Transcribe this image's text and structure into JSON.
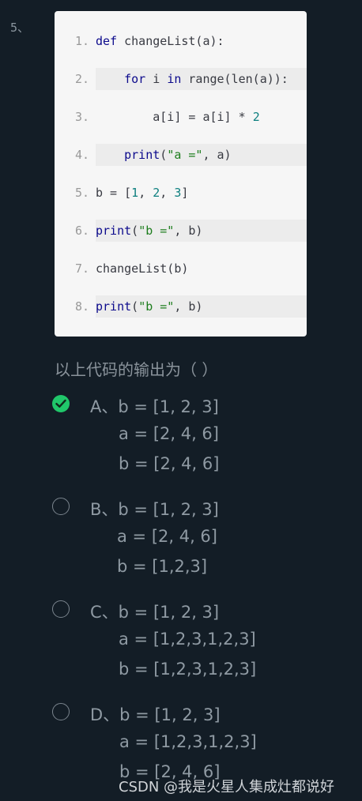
{
  "question_number": "5、",
  "code": {
    "lines": [
      {
        "n": "1.",
        "parts": [
          {
            "t": "def ",
            "c": "kw"
          },
          {
            "t": "changeList(a):",
            "c": "fn"
          }
        ]
      },
      {
        "n": "2.",
        "parts": [
          {
            "t": "    ",
            "c": "op"
          },
          {
            "t": "for",
            "c": "kw"
          },
          {
            "t": " i ",
            "c": "op"
          },
          {
            "t": "in",
            "c": "kw"
          },
          {
            "t": " range(len(a)):",
            "c": "fn"
          }
        ]
      },
      {
        "n": "3.",
        "parts": [
          {
            "t": "        a[i] = a[i] * ",
            "c": "op"
          },
          {
            "t": "2",
            "c": "num"
          }
        ]
      },
      {
        "n": "4.",
        "parts": [
          {
            "t": "    ",
            "c": "op"
          },
          {
            "t": "print",
            "c": "kw"
          },
          {
            "t": "(",
            "c": "op"
          },
          {
            "t": "\"a =\"",
            "c": "str"
          },
          {
            "t": ", a)",
            "c": "op"
          }
        ]
      },
      {
        "n": "5.",
        "parts": [
          {
            "t": "b = [",
            "c": "op"
          },
          {
            "t": "1",
            "c": "num"
          },
          {
            "t": ", ",
            "c": "op"
          },
          {
            "t": "2",
            "c": "num"
          },
          {
            "t": ", ",
            "c": "op"
          },
          {
            "t": "3",
            "c": "num"
          },
          {
            "t": "]",
            "c": "op"
          }
        ]
      },
      {
        "n": "6.",
        "parts": [
          {
            "t": "print",
            "c": "kw"
          },
          {
            "t": "(",
            "c": "op"
          },
          {
            "t": "\"b =\"",
            "c": "str"
          },
          {
            "t": ", b)",
            "c": "op"
          }
        ]
      },
      {
        "n": "7.",
        "parts": [
          {
            "t": "changeList(b)",
            "c": "fn"
          }
        ]
      },
      {
        "n": "8.",
        "parts": [
          {
            "t": "print",
            "c": "kw"
          },
          {
            "t": "(",
            "c": "op"
          },
          {
            "t": "\"b =\"",
            "c": "str"
          },
          {
            "t": ", b)",
            "c": "op"
          }
        ]
      }
    ],
    "highlighted_lines": [
      2,
      4,
      6,
      8
    ]
  },
  "question_text": "以上代码的输出为（ ）",
  "options": [
    {
      "id": "A",
      "selected": true,
      "lines": [
        "A、b = [1, 2, 3]",
        "a = [2, 4, 6]",
        "b = [2, 4, 6]"
      ]
    },
    {
      "id": "B",
      "selected": false,
      "lines": [
        "B、b = [1, 2, 3]",
        "a = [2, 4, 6]",
        "b = [1,2,3]"
      ]
    },
    {
      "id": "C",
      "selected": false,
      "lines": [
        "C、b = [1, 2, 3]",
        "a = [1,2,3,1,2,3]",
        "b = [1,2,3,1,2,3]"
      ]
    },
    {
      "id": "D",
      "selected": false,
      "lines": [
        "D、b = [1, 2, 3]",
        "a = [1,2,3,1,2,3]",
        "b = [2, 4, 6]"
      ]
    }
  ],
  "watermark": "CSDN @我是火星人集成灶都说好",
  "colors": {
    "background": "#131d26",
    "code_bg": "#f6f6f6",
    "check_green": "#20c76a"
  }
}
